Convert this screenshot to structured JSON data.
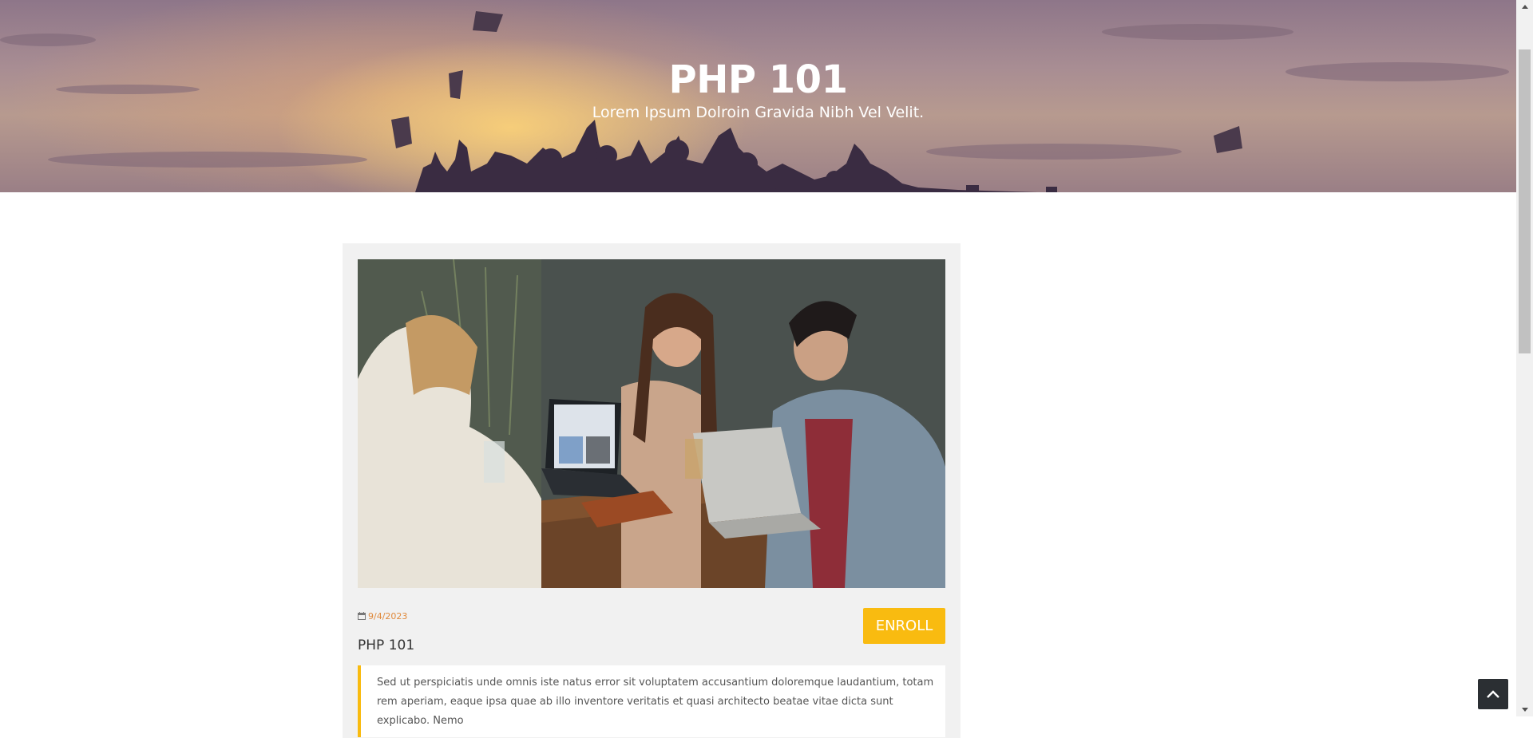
{
  "hero": {
    "title": "PHP 101",
    "subtitle": "Lorem Ipsum Dolroin Gravida Nibh Vel Velit."
  },
  "course": {
    "image_alt": "Three people laughing at a table with laptops",
    "date": "9/4/2023",
    "date_icon": "calendar-icon",
    "enroll_label": "ENROLL",
    "title": "PHP 101",
    "description": "Sed ut perspiciatis unde omnis iste natus error sit voluptatem accusantium doloremque laudantium, totam rem aperiam, eaque ipsa quae ab illo inventore veritatis et quasi architecto beatae vitae dicta sunt explicabo. Nemo"
  },
  "colors": {
    "accent": "#f9bb10",
    "date_text": "#e08a3c",
    "card_bg": "#f1f1f1",
    "back_to_top_bg": "#2b2f33"
  },
  "icons": {
    "back_to_top": "chevron-up-icon",
    "scroll_up": "arrow-up-icon",
    "scroll_down": "arrow-down-icon"
  }
}
